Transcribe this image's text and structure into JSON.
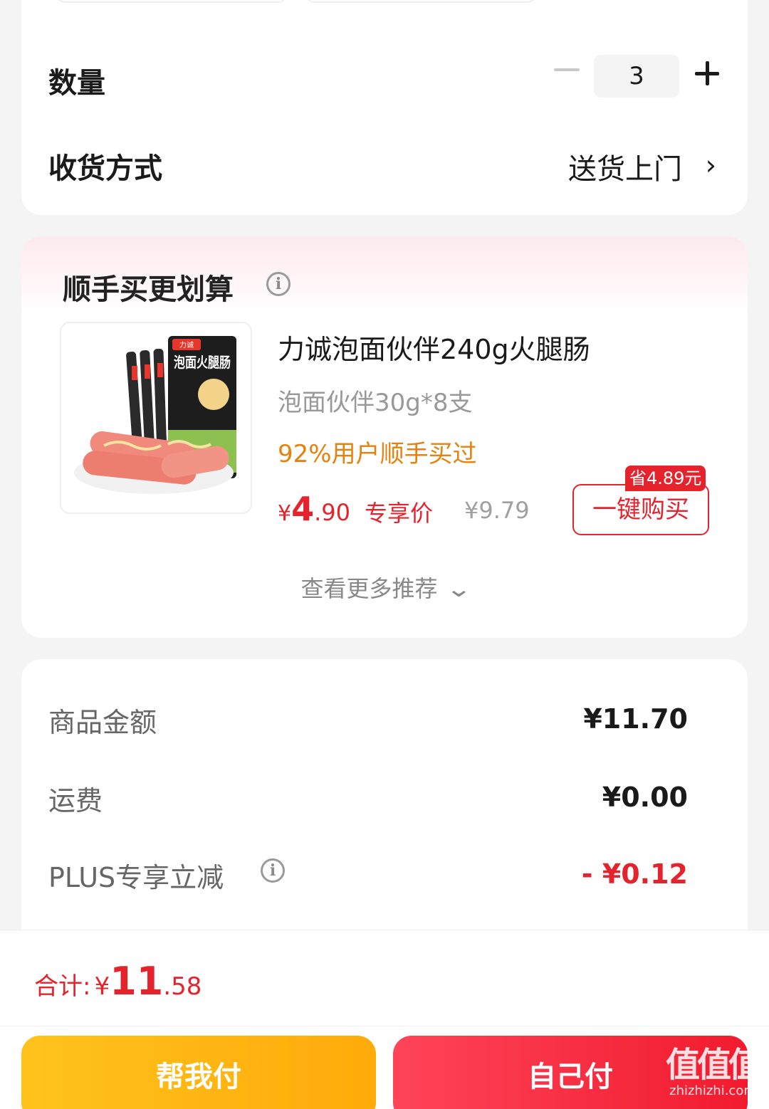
{
  "order": {
    "quantity_label": "数量",
    "quantity_value": "3",
    "delivery_label": "收货方式",
    "delivery_value": "送货上门"
  },
  "recommend": {
    "title": "顺手买更划算",
    "product": {
      "name": "力诚泡面伙伴240g火腿肠",
      "spec": "泡面伙伴30g*8支",
      "stat": "92%用户顺手买过",
      "price_currency": "¥",
      "price_int": "4",
      "price_dec": ".90",
      "price_tag": "专享价",
      "original_price": "¥9.79",
      "save_badge": "省4.89元",
      "buy_label": "一键购买",
      "package_brand": "力诚",
      "package_title": "泡面火腿肠"
    },
    "more_label": "查看更多推荐"
  },
  "summary": {
    "items_label": "商品金额",
    "items_value": "¥11.70",
    "shipping_label": "运费",
    "shipping_value": "¥0.00",
    "plus_label": "PLUS专享立减",
    "plus_value": "- ¥0.12"
  },
  "footer": {
    "total_label": "合计:",
    "total_currency": "¥",
    "total_int": "11",
    "total_dec": ".58",
    "help_pay_label": "帮我付",
    "self_pay_label": "自己付",
    "watermark_big": "值值值",
    "watermark_small": "zhizhizhi.com"
  },
  "colors": {
    "accent_red": "#e5232d",
    "orange": "#e5820e",
    "yellow_button": "#ffb812",
    "red_button": "#f5283c"
  },
  "icons": [
    "minus-icon",
    "plus-icon",
    "chevron-right-icon",
    "info-icon",
    "chevron-down-icon"
  ]
}
